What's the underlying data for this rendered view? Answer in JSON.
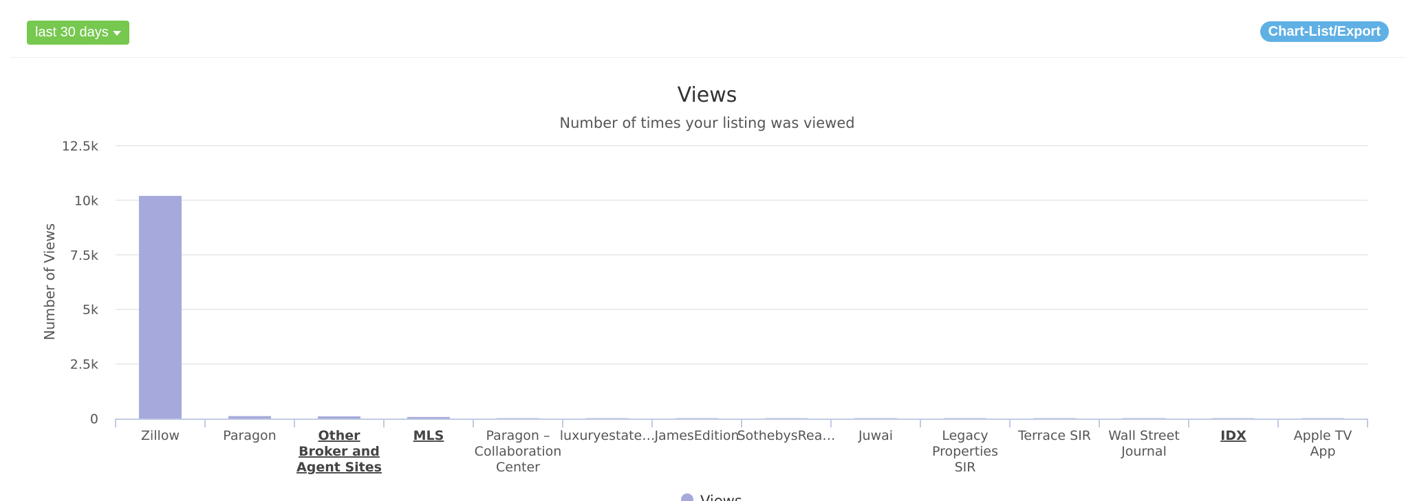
{
  "toolbar": {
    "range_label": "last 30 days",
    "export_label": "Chart-List/Export"
  },
  "chart_data": {
    "type": "bar",
    "title": "Views",
    "subtitle": "Number of times your listing was viewed",
    "xlabel": "",
    "ylabel": "Number of Views",
    "ylim": [
      0,
      12500
    ],
    "yticks": [
      "0",
      "2.5k",
      "5k",
      "7.5k",
      "10k",
      "12.5k"
    ],
    "ytick_values": [
      0,
      2500,
      5000,
      7500,
      10000,
      12500
    ],
    "grid": true,
    "bar_color": "#a6a9db",
    "categories": [
      {
        "label": "Zillow",
        "lines": [
          "Zillow"
        ],
        "link": false
      },
      {
        "label": "Paragon",
        "lines": [
          "Paragon"
        ],
        "link": false
      },
      {
        "label": "Other Broker and Agent Sites",
        "lines": [
          "Other",
          "Broker and",
          "Agent Sites"
        ],
        "link": true
      },
      {
        "label": "MLS",
        "lines": [
          "MLS"
        ],
        "link": true
      },
      {
        "label": "Paragon – Collaboration Center",
        "lines": [
          "Paragon –",
          "Collaboration",
          "Center"
        ],
        "link": false
      },
      {
        "label": "luxuryestate…",
        "lines": [
          "luxuryestate…"
        ],
        "link": false
      },
      {
        "label": "JamesEdition",
        "lines": [
          "JamesEdition"
        ],
        "link": false
      },
      {
        "label": "SothebysRea…",
        "lines": [
          "SothebysRea…"
        ],
        "link": false
      },
      {
        "label": "Juwai",
        "lines": [
          "Juwai"
        ],
        "link": false
      },
      {
        "label": "Legacy Properties SIR",
        "lines": [
          "Legacy",
          "Properties",
          "SIR"
        ],
        "link": false
      },
      {
        "label": "Terrace SIR",
        "lines": [
          "Terrace SIR"
        ],
        "link": false
      },
      {
        "label": "Wall Street Journal",
        "lines": [
          "Wall Street",
          "Journal"
        ],
        "link": false
      },
      {
        "label": "IDX",
        "lines": [
          "IDX"
        ],
        "link": true
      },
      {
        "label": "Apple TV App",
        "lines": [
          "Apple TV",
          "App"
        ],
        "link": false
      }
    ],
    "series": [
      {
        "name": "Views",
        "values": [
          10200,
          110,
          100,
          70,
          15,
          10,
          8,
          6,
          5,
          4,
          3,
          3,
          2,
          1
        ]
      }
    ],
    "legend": {
      "placement": "bottom-center"
    }
  }
}
